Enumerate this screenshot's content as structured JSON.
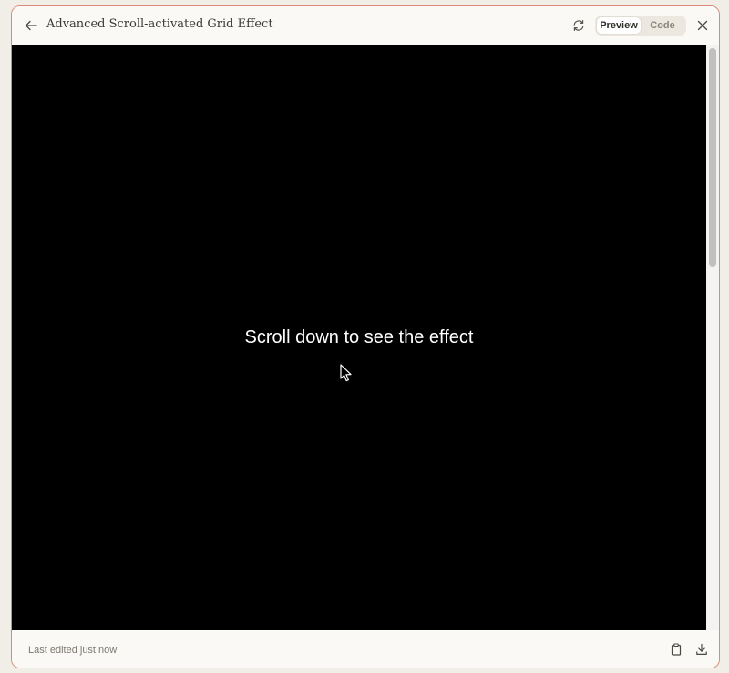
{
  "header": {
    "title": "Advanced Scroll-activated Grid Effect",
    "back_icon": "arrow-left-icon",
    "refresh_icon": "refresh-icon",
    "close_icon": "close-icon",
    "tabs": [
      {
        "label": "Preview",
        "active": true
      },
      {
        "label": "Code",
        "active": false
      }
    ]
  },
  "preview": {
    "text": "Scroll down to see the effect",
    "background": "#000000",
    "text_color": "#ffffff"
  },
  "footer": {
    "status": "Last edited just now",
    "copy_icon": "clipboard-icon",
    "download_icon": "download-icon"
  },
  "colors": {
    "accent_border": "#d98b76",
    "toggle_bg": "#ece8df"
  }
}
